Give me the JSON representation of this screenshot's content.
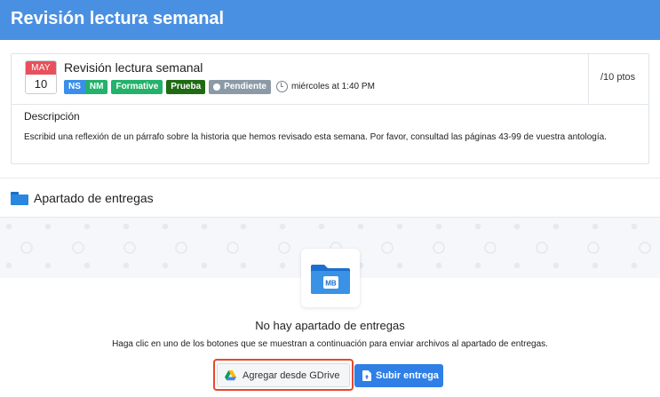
{
  "header": {
    "title": "Revisión lectura semanal"
  },
  "assignment": {
    "date_month": "MAY",
    "date_day": "10",
    "title": "Revisión lectura semanal",
    "tags": {
      "ns": "NS",
      "nm": "NM",
      "formative": "Formative",
      "prueba": "Prueba"
    },
    "status": "Pendiente",
    "due": "miércoles at 1:40 PM",
    "points": "/10 ptos",
    "description_label": "Descripción",
    "description": "Escribid una reflexión de un párrafo sobre la historia que hemos revisado esta semana. Por favor, consultad las páginas 43-99 de vuestra antología."
  },
  "submissions": {
    "title": "Apartado de entregas",
    "empty_title": "No hay apartado de entregas",
    "empty_message": "Haga clic en uno de los botones que se muestran a continuación para enviar archivos al apartado de entregas.",
    "folder_badge": "MB",
    "gdrive_button": "Agregar desde GDrive",
    "upload_button": "Subir entrega"
  },
  "colors": {
    "header": "#4a90e2",
    "primary_button": "#2f7fe6",
    "highlight": "#e8472d",
    "date_month": "#e8505b"
  },
  "icons": [
    "folder-icon",
    "clock-icon",
    "google-drive-icon",
    "upload-file-icon",
    "status-dot-icon"
  ]
}
